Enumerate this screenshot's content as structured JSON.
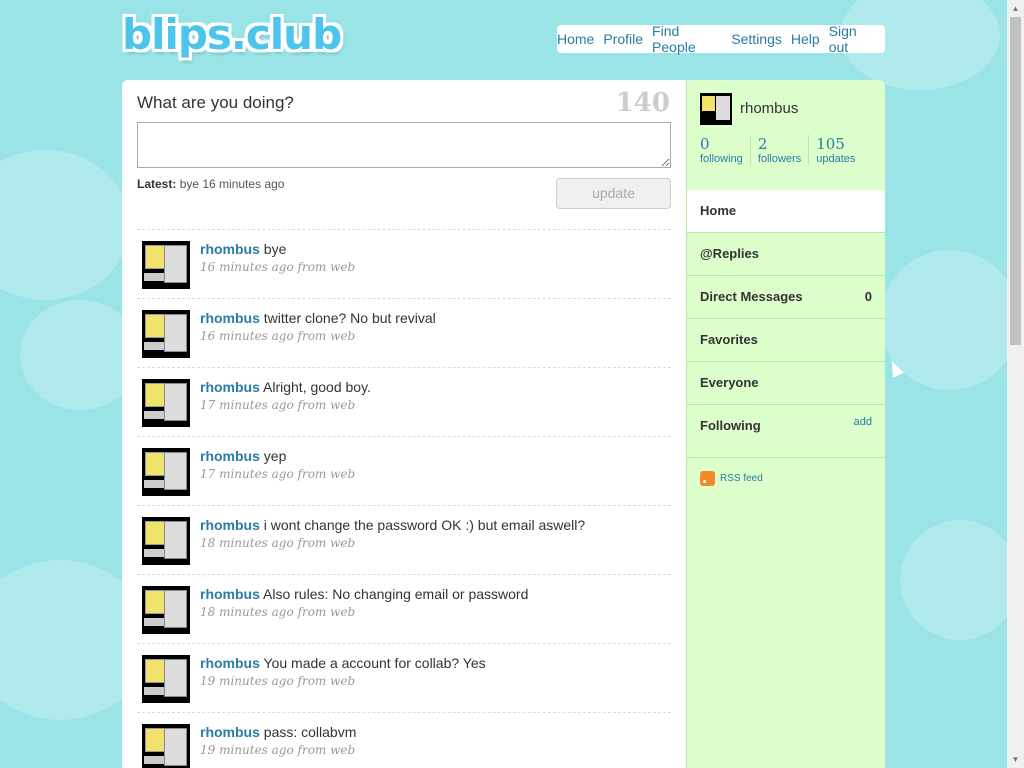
{
  "logo": "blips.club",
  "nav": [
    "Home",
    "Profile",
    "Find People",
    "Settings",
    "Help",
    "Sign out"
  ],
  "compose": {
    "prompt": "What are you doing?",
    "counter": "140",
    "latest_label": "Latest:",
    "latest_text": "bye 16 minutes ago",
    "update_label": "update"
  },
  "tweets": [
    {
      "user": "rhombus",
      "text": "bye",
      "meta": "16 minutes ago from web"
    },
    {
      "user": "rhombus",
      "text": "twitter clone? No but revival",
      "meta": "16 minutes ago from web"
    },
    {
      "user": "rhombus",
      "text": "Alright, good boy.",
      "meta": "17 minutes ago from web"
    },
    {
      "user": "rhombus",
      "text": "yep",
      "meta": "17 minutes ago from web"
    },
    {
      "user": "rhombus",
      "text": "i wont change the password OK :) but email aswell?",
      "meta": "18 minutes ago from web"
    },
    {
      "user": "rhombus",
      "text": "Also rules: No changing email or password",
      "meta": "18 minutes ago from web"
    },
    {
      "user": "rhombus",
      "text": "You made a account for collab? Yes",
      "meta": "19 minutes ago from web"
    },
    {
      "user": "rhombus",
      "text": "pass: collabvm",
      "meta": "19 minutes ago from web"
    }
  ],
  "sidebar": {
    "username": "rhombus",
    "stats": [
      {
        "n": "0",
        "label": "following"
      },
      {
        "n": "2",
        "label": "followers"
      },
      {
        "n": "105",
        "label": "updates"
      }
    ],
    "menu": {
      "home": "Home",
      "replies": "@Replies",
      "dm": "Direct Messages",
      "dm_count": "0",
      "favorites": "Favorites",
      "everyone": "Everyone",
      "following": "Following",
      "add": "add"
    },
    "rss": "RSS feed"
  }
}
